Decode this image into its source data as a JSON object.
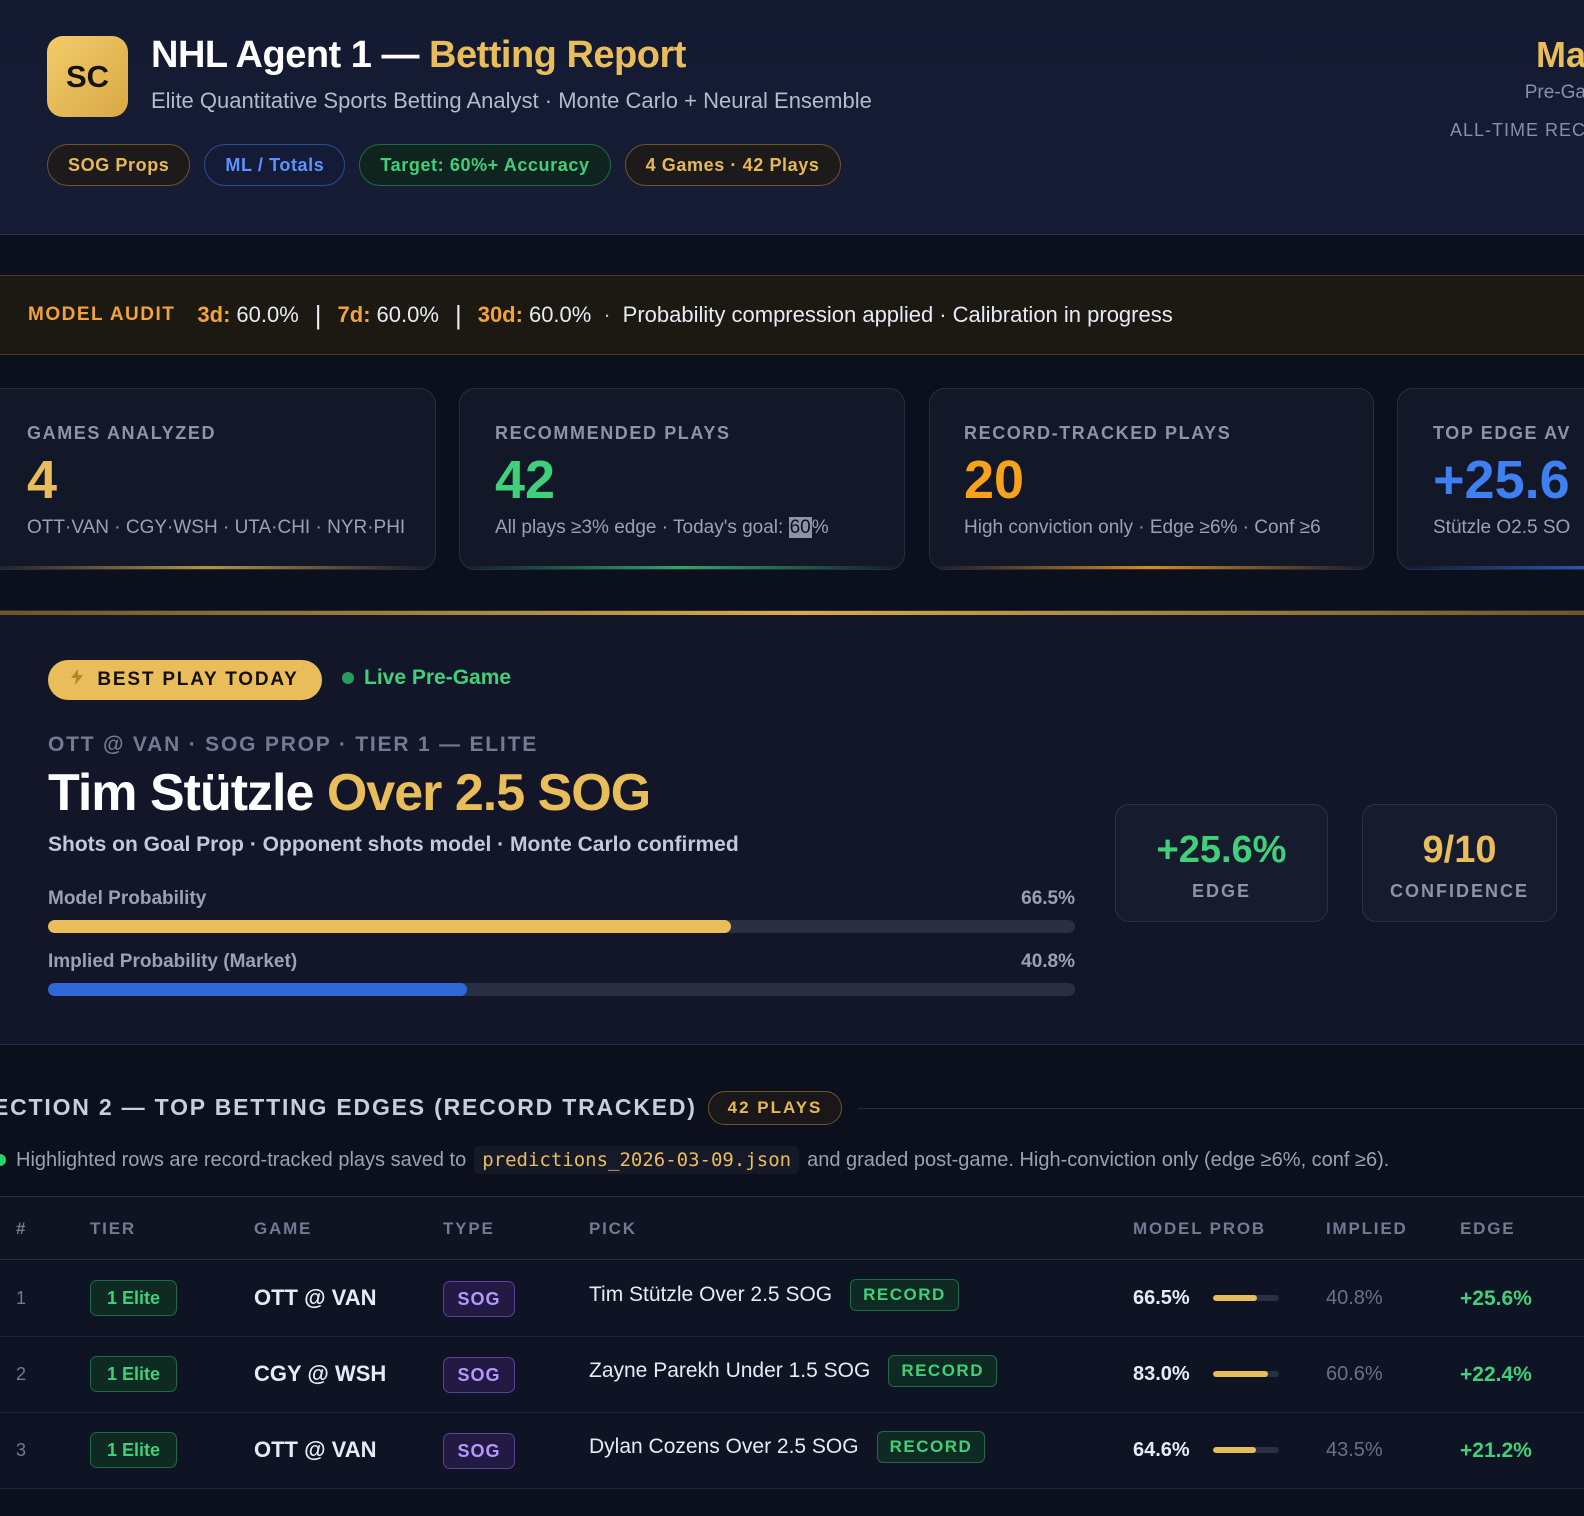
{
  "header": {
    "logo": "SC",
    "title_main": "NHL Agent 1 — ",
    "title_accent": "Betting Report",
    "subtitle": "Elite Quantitative Sports Betting Analyst · Monte Carlo + Neural Ensemble",
    "tags": [
      "SOG Props",
      "ML / Totals",
      "Target: 60%+ Accuracy",
      "4 Games · 42 Plays"
    ],
    "right_title": "Ma",
    "right_sub": "Pre-Ga",
    "right_record": "ALL-TIME REC"
  },
  "audit": {
    "label": "MODEL AUDIT",
    "k3": "3d:",
    "v3": "60.0%",
    "k7": "7d:",
    "v7": "60.0%",
    "k30": "30d:",
    "v30": "60.0%",
    "note1": "Probability compression applied",
    "note2": "Calibration in progress"
  },
  "stats": [
    {
      "label": "GAMES ANALYZED",
      "value": "4",
      "sub": "OTT·VAN · CGY·WSH · UTA·CHI · NYR·PHI",
      "color": "#e9bd5a"
    },
    {
      "label": "RECOMMENDED PLAYS",
      "value": "42",
      "sub_a": "All plays ≥3% edge · Today's goal: ",
      "sub_hl": "60",
      "sub_b": "%",
      "color": "#3fd07a"
    },
    {
      "label": "RECORD-TRACKED PLAYS",
      "value": "20",
      "sub": "High conviction only · Edge ≥6% · Conf ≥6",
      "color": "#f7a21b"
    },
    {
      "label": "TOP EDGE AV",
      "value": "+25.6",
      "sub": "Stützle O2.5 SO",
      "color": "#3f7ff2"
    }
  ],
  "best": {
    "badge": "BEST PLAY TODAY",
    "live": "Live Pre-Game",
    "meta": "OTT @ VAN · SOG PROP · TIER 1 — ELITE",
    "player": "Tim Stützle ",
    "pick": "Over 2.5 SOG",
    "desc": "Shots on Goal Prop · Opponent shots model · Monte Carlo confirmed",
    "model_label": "Model Probability",
    "model_value": "66.5%",
    "model_fraction": 0.665,
    "implied_label": "Implied Probability (Market)",
    "implied_value": "40.8%",
    "implied_fraction": 0.408,
    "edge": "+25.6%",
    "edge_label": "EDGE",
    "confidence": "9/10",
    "confidence_label": "CONFIDENCE"
  },
  "section2": {
    "title": "ECTION 2 — TOP BETTING EDGES (RECORD TRACKED)",
    "badge": "42 PLAYS",
    "note_a": "Highlighted rows are record-tracked plays saved to",
    "note_code": "predictions_2026-03-09.json",
    "note_b": "and graded post-game. High-conviction only (edge ≥6%, conf ≥6).",
    "columns": [
      "#",
      "TIER",
      "GAME",
      "TYPE",
      "PICK",
      "MODEL PROB",
      "IMPLIED",
      "EDGE"
    ],
    "rows": [
      {
        "num": "1",
        "tier": "1 Elite",
        "game": "OTT @ VAN",
        "type": "SOG",
        "pick": "Tim Stützle Over 2.5 SOG",
        "record": "RECORD",
        "model": "66.5%",
        "model_fraction": 0.665,
        "implied": "40.8%",
        "edge": "+25.6%"
      },
      {
        "num": "2",
        "tier": "1 Elite",
        "game": "CGY @ WSH",
        "type": "SOG",
        "pick": "Zayne Parekh Under 1.5 SOG",
        "record": "RECORD",
        "model": "83.0%",
        "model_fraction": 0.83,
        "implied": "60.6%",
        "edge": "+22.4%"
      },
      {
        "num": "3",
        "tier": "1 Elite",
        "game": "OTT @ VAN",
        "type": "SOG",
        "pick": "Dylan Cozens Over 2.5 SOG",
        "record": "RECORD",
        "model": "64.6%",
        "model_fraction": 0.646,
        "implied": "43.5%",
        "edge": "+21.2%"
      }
    ]
  }
}
